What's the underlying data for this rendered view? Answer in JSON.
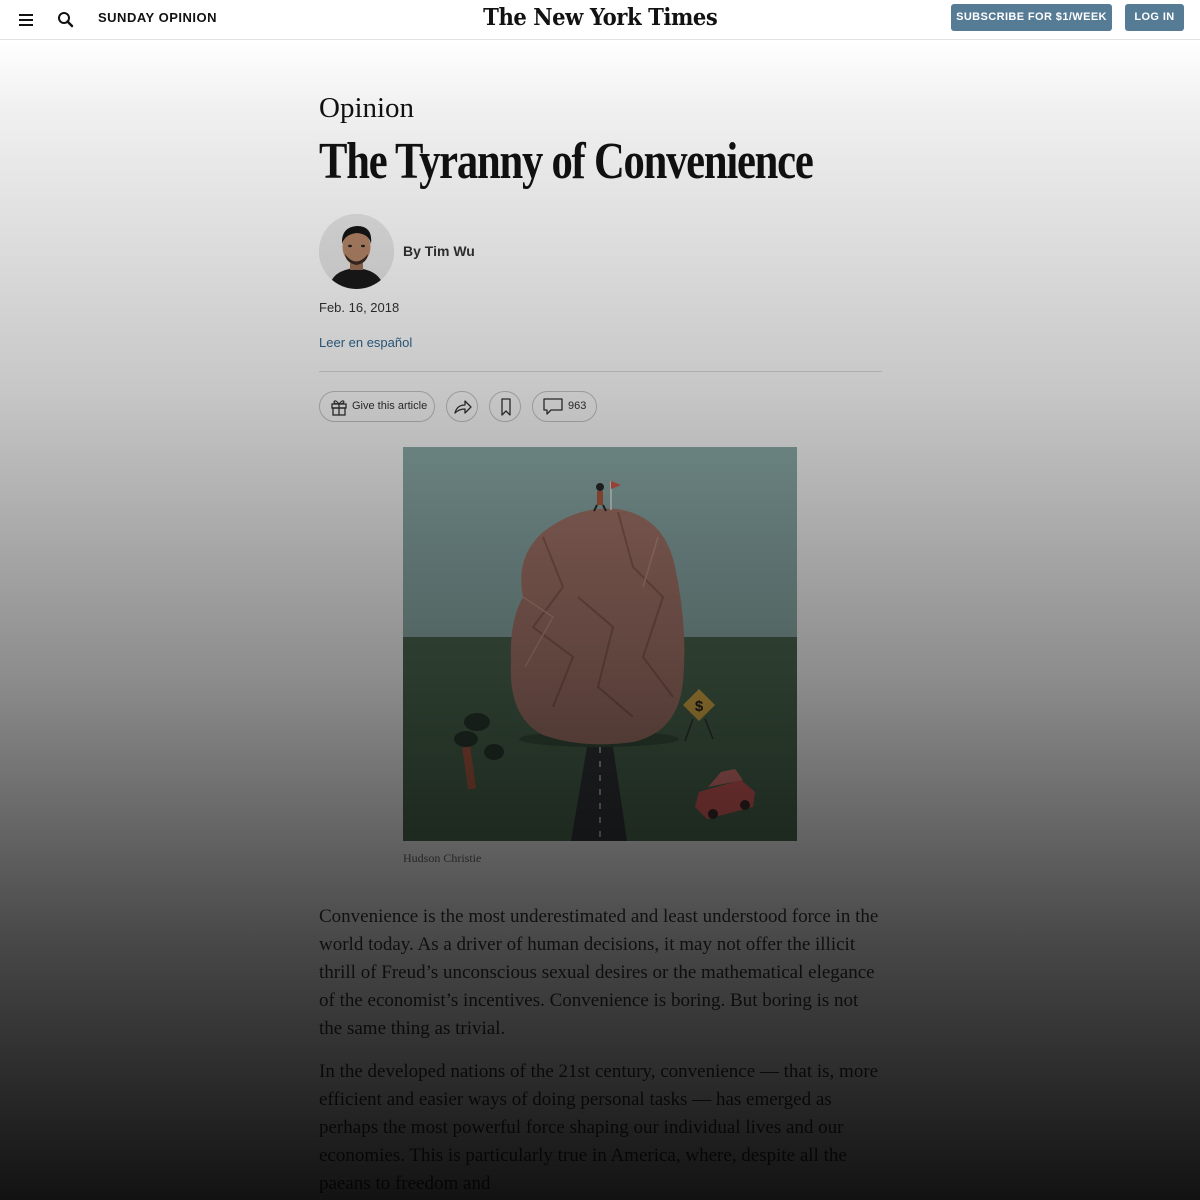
{
  "header": {
    "section": "SUNDAY OPINION",
    "logo": "The New York Times",
    "subscribe_label": "SUBSCRIBE FOR $1/WEEK",
    "login_label": "LOG IN"
  },
  "article": {
    "kicker": "Opinion",
    "headline": "The Tyranny of Convenience",
    "byline": "By Tim Wu",
    "date": "Feb. 16, 2018",
    "translate_link": "Leer en español",
    "actions": {
      "gift_label": "Give this article",
      "comment_count": "963"
    },
    "image_credit": "Hudson Christie",
    "paragraphs": [
      "Convenience is the most underestimated and least understood force in the world today. As a driver of human decisions, it may not offer the illicit thrill of Freud’s unconscious sexual desires or the mathematical elegance of the economist’s incentives. Convenience is boring. But boring is not the same thing as trivial.",
      "In the developed nations of the 21st century, convenience — that is, more efficient and easier ways of doing personal tasks — has emerged as perhaps the most powerful force shaping our individual lives and our economies. This is particularly true in America, where, despite all the paeans to freedom and"
    ]
  },
  "colors": {
    "button_blue": "#567b95",
    "link_blue": "#326891",
    "text": "#121212"
  },
  "icons": [
    "menu-icon",
    "search-icon",
    "gift-icon",
    "share-icon",
    "bookmark-icon",
    "comment-icon"
  ]
}
